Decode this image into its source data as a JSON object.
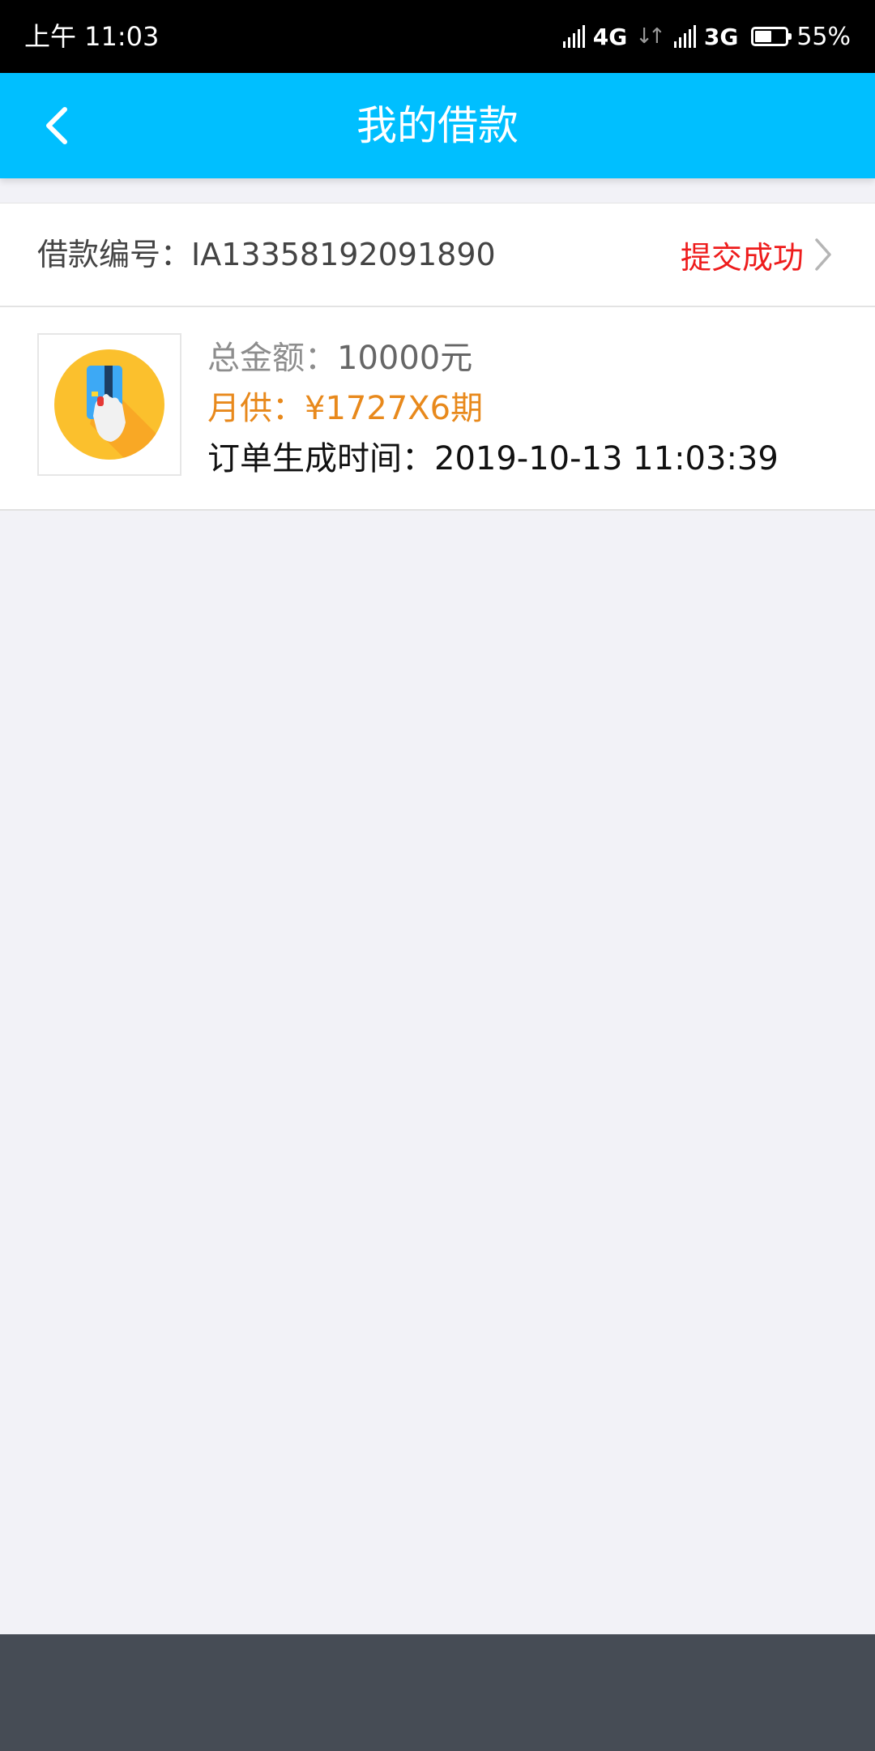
{
  "status_bar": {
    "time": "上午 11:03",
    "network1": "4G",
    "network2": "3G",
    "battery_text": "55%",
    "battery_level": 0.55
  },
  "header": {
    "title": "我的借款",
    "back_icon": "chevron-left-icon",
    "background_color": "#00bfff"
  },
  "loan": {
    "number_label": "借款编号：",
    "number": "IA13358192091890",
    "status": "提交成功",
    "status_color": "#ee1c1c",
    "total_label": "总金额：",
    "total_value": "10000元",
    "monthly_text": "月供：¥1727X6期",
    "monthly_color": "#e8891c",
    "created_label": "订单生成时间：",
    "created_value": "2019-10-13 11:03:39",
    "thumbnail_icon": "credit-card-hand-icon"
  }
}
